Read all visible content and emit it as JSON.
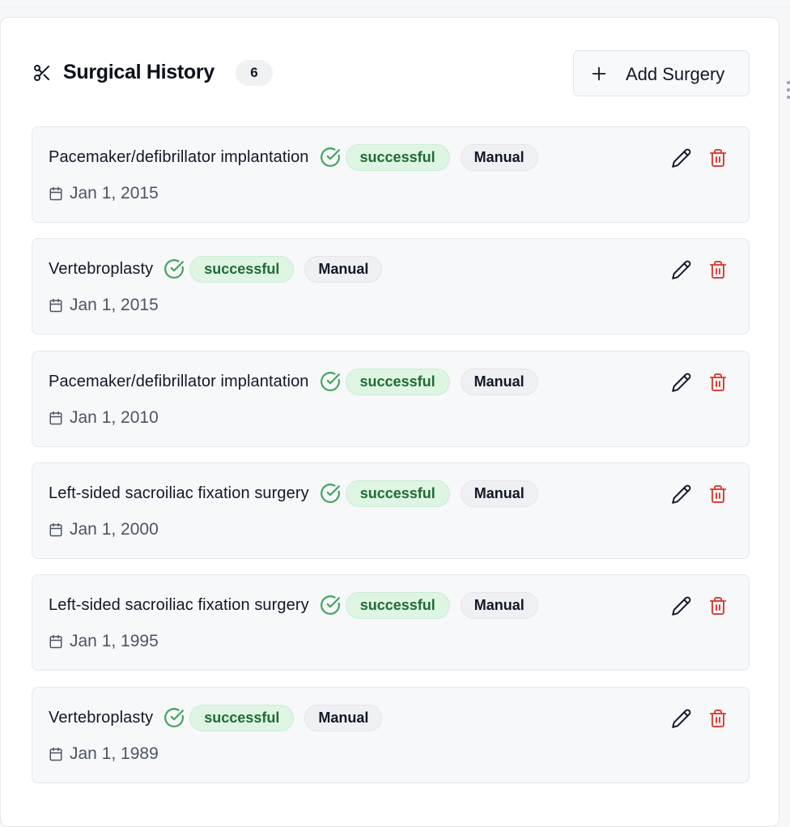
{
  "header": {
    "title": "Surgical History",
    "count": "6",
    "add_button_label": "Add Surgery",
    "icon": "scissors-icon"
  },
  "surgeries": [
    {
      "name": "Pacemaker/defibrillator implantation",
      "status": "successful",
      "source": "Manual",
      "date": "Jan 1, 2015"
    },
    {
      "name": "Vertebroplasty",
      "status": "successful",
      "source": "Manual",
      "date": "Jan 1, 2015"
    },
    {
      "name": "Pacemaker/defibrillator implantation",
      "status": "successful",
      "source": "Manual",
      "date": "Jan 1, 2010"
    },
    {
      "name": "Left-sided sacroiliac fixation surgery",
      "status": "successful",
      "source": "Manual",
      "date": "Jan 1, 2000"
    },
    {
      "name": "Left-sided sacroiliac fixation surgery",
      "status": "successful",
      "source": "Manual",
      "date": "Jan 1, 1995"
    },
    {
      "name": "Vertebroplasty",
      "status": "successful",
      "source": "Manual",
      "date": "Jan 1, 1989"
    }
  ],
  "colors": {
    "success_text": "#1f6b34",
    "success_bg": "#dff5e3",
    "success_icon": "#3fa45a",
    "delete": "#d9443a"
  }
}
